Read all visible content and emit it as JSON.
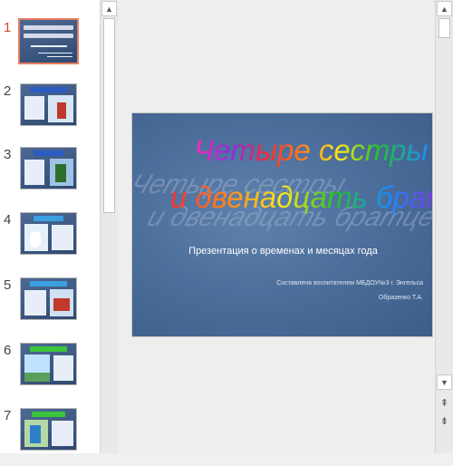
{
  "thumbnails": [
    {
      "number": "1",
      "selected": true,
      "icon": "slide-thumbnail-title"
    },
    {
      "number": "2",
      "selected": false,
      "icon": "slide-thumbnail-winter"
    },
    {
      "number": "3",
      "selected": false,
      "icon": "slide-thumbnail-winter-child"
    },
    {
      "number": "4",
      "selected": false,
      "icon": "slide-thumbnail-snowman"
    },
    {
      "number": "5",
      "selected": false,
      "icon": "slide-thumbnail-sled"
    },
    {
      "number": "6",
      "selected": false,
      "icon": "slide-thumbnail-spring"
    },
    {
      "number": "7",
      "selected": false,
      "icon": "slide-thumbnail-spring-child"
    }
  ],
  "slide": {
    "title_line1": "Четыре сестры",
    "title_line2": "и двенадцать братцев",
    "subtitle": "Презентация о временах и месяцах года",
    "author_line1": "Составлена воспитателем МБДОУ№3 г. Энгельса",
    "author_line2": "Образенко Т.А."
  },
  "colors": {
    "slide_background": "#4d6f9c",
    "selection_accent": "#d24726",
    "rainbow": [
      "#ff2a2a",
      "#ff8c1a",
      "#ffe81a",
      "#27c127",
      "#1a8cff",
      "#8a2be2",
      "#ff2ab4"
    ]
  }
}
